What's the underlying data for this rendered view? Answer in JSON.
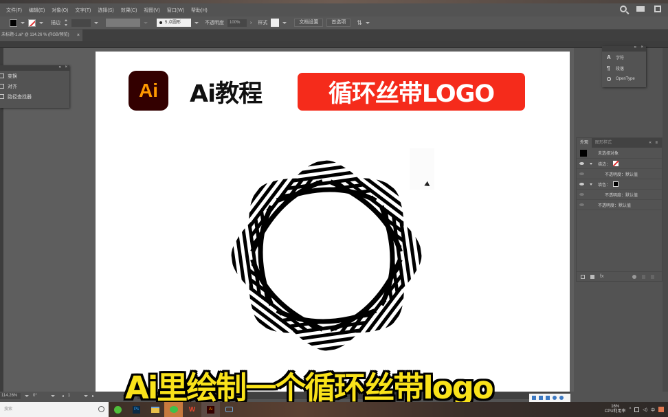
{
  "menubar": {
    "items": [
      "文件(F)",
      "编辑(E)",
      "对象(O)",
      "文字(T)",
      "选择(S)",
      "效果(C)",
      "视图(V)",
      "窗口(W)",
      "帮助(H)"
    ]
  },
  "controlbar": {
    "stroke_label": "描边",
    "brush_label": "5 点圆形",
    "opacity_label": "不透明度",
    "opacity_value": "100%",
    "style_label": "样式",
    "doc_setup_button": "文档设置",
    "preferences_button": "首选项"
  },
  "document_tab": {
    "title": "未标题-1.ai* @ 114.26 % (RGB/预览)",
    "close": "×"
  },
  "artboard": {
    "ai_logo_text": "Ai",
    "tutorial_title": "Ai教程",
    "banner_text": "循环丝带LOGO",
    "ribbon_logo": "8-point looping striped ribbon",
    "colors": {
      "banner_red": "#f52b1b",
      "ai_logo_bg": "#330000",
      "ai_logo_fg": "#ff9a00"
    }
  },
  "left_panel": {
    "items": [
      "变换",
      "对齐",
      "路径查找器"
    ]
  },
  "char_panel": {
    "items": [
      {
        "glyph": "A",
        "label": "字符"
      },
      {
        "glyph": "¶",
        "label": "段落"
      },
      {
        "glyph": "O",
        "label": "OpenType"
      }
    ]
  },
  "appearance_panel": {
    "tabs": [
      "外观",
      "图形样式"
    ],
    "object_label": "未选择对象",
    "rows": [
      {
        "label": "描边：",
        "type": "stroke"
      },
      {
        "label": "不透明度：默认值",
        "type": "sub"
      },
      {
        "label": "填色：",
        "type": "fill"
      },
      {
        "label": "不透明度：默认值",
        "type": "sub"
      },
      {
        "label": "不透明度：默认值",
        "type": "top"
      }
    ]
  },
  "statusbar": {
    "zoom": "114.26%",
    "rotation": "0°",
    "artboard_num": "1"
  },
  "subtitle": "Ai里绘制一个循环丝带logo",
  "taskbar": {
    "search_placeholder": "搜索",
    "apps": [
      "360",
      "Ps",
      "文件资源管理器",
      "微信",
      "WPS",
      "Ai",
      "录屏"
    ],
    "cpu_percent": "16%",
    "cpu_label": "CPU利用率",
    "ime": "中"
  }
}
